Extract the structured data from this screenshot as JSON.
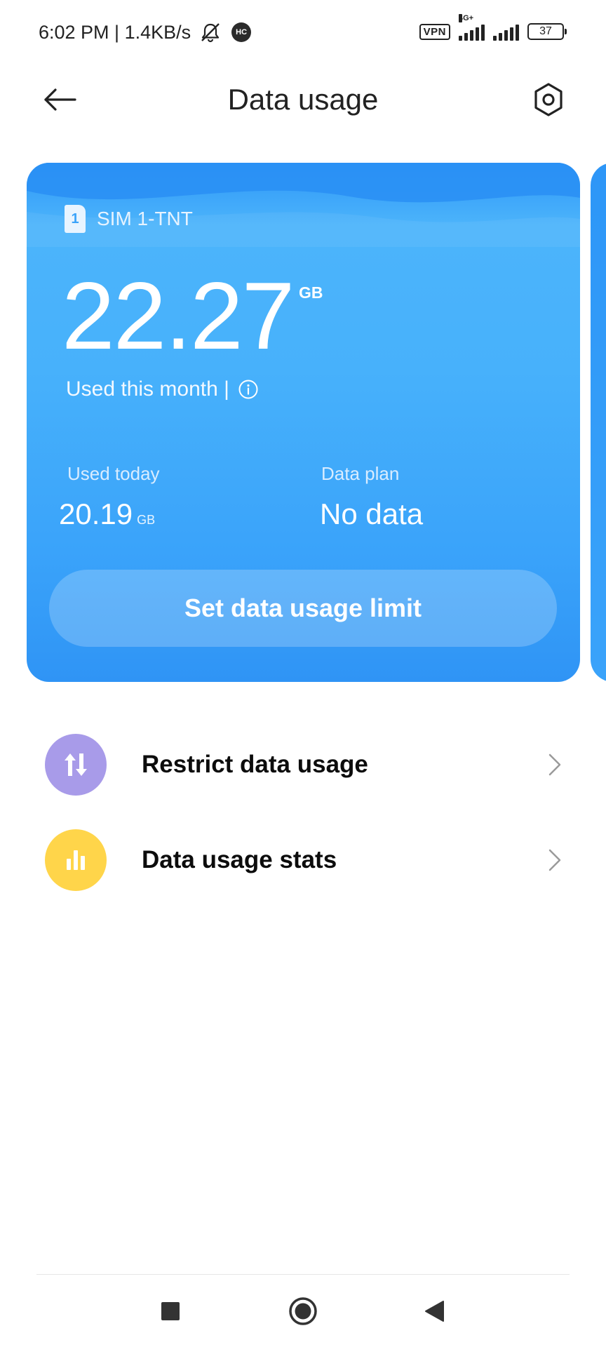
{
  "status_bar": {
    "time_speed": "6:02 PM | 1.4KB/s",
    "hc_badge": "HC",
    "vpn": "VPN",
    "network_type": "4G+",
    "battery": "37"
  },
  "header": {
    "title": "Data usage",
    "back_icon": "arrow-left-icon",
    "settings_icon": "gear-icon"
  },
  "card": {
    "sim_badge": "1",
    "sim_name": "SIM 1-TNT",
    "used_value": "22.27",
    "used_unit": "GB",
    "used_label": "Used this month |",
    "used_today_label": "Used today",
    "used_today_value": "20.19",
    "used_today_unit": "GB",
    "plan_label": "Data plan",
    "plan_value": "No data",
    "limit_button": "Set data usage limit",
    "colors": {
      "card_top": "#2d96f7",
      "card_mid": "#47b1fb"
    }
  },
  "list": [
    {
      "label": "Restrict data usage",
      "icon": "arrows-up-down-icon",
      "color": "#a89be9"
    },
    {
      "label": "Data usage stats",
      "icon": "bar-chart-icon",
      "color": "#ffd54a"
    }
  ],
  "nav": {
    "recent_icon": "square-icon",
    "home_icon": "circle-icon",
    "back_icon": "triangle-back-icon"
  }
}
